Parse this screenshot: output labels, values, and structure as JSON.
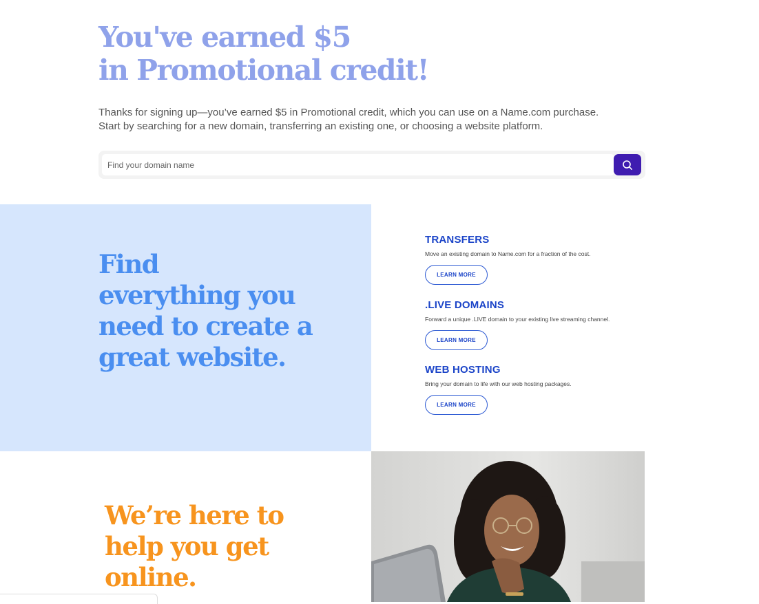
{
  "hero": {
    "title_line1": "You've earned $5",
    "title_line2": "in Promotional credit!",
    "sub_line1": "Thanks for signing up—you’ve earned $5 in Promotional credit, which you can use on a Name.com purchase.",
    "sub_line2": "Start by searching for a new domain, transferring an existing one, or choosing a website platform."
  },
  "search": {
    "placeholder": "Find your domain name",
    "button_icon": "search-icon"
  },
  "features_section": {
    "title_lines": [
      "Find",
      "everything you",
      "need to create a",
      "great website."
    ],
    "items": [
      {
        "title": "TRANSFERS",
        "desc": "Move an existing domain to Name.com for a fraction of the cost.",
        "button": "LEARN MORE"
      },
      {
        "title": ".LIVE DOMAINS",
        "desc": "Forward a unique .LIVE domain to your existing live streaming channel.",
        "button": "LEARN MORE"
      },
      {
        "title": "WEB HOSTING",
        "desc": "Bring your domain to life with our web hosting packages.",
        "button": "LEARN MORE"
      }
    ]
  },
  "help_section": {
    "title_lines": [
      "We’re here to",
      "help you get",
      "online."
    ]
  },
  "colors": {
    "hero_title": "#8fa2ea",
    "search_button": "#3f1cb0",
    "blue_panel": "#d6e6fd",
    "blue_title": "#4a8ef0",
    "feature_title": "#1b44c8",
    "orange_title": "#f7941e"
  }
}
